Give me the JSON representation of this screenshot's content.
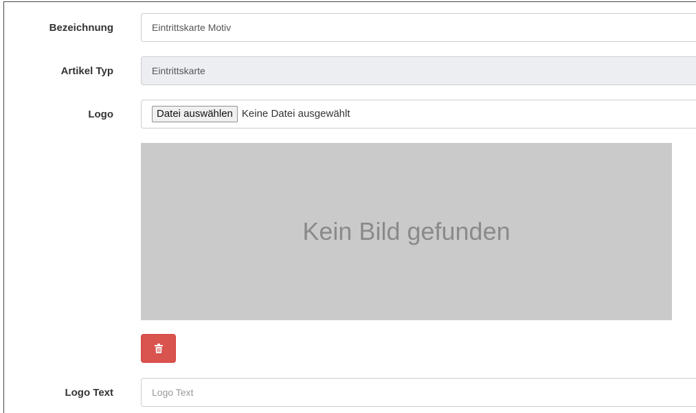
{
  "form": {
    "bezeichnung": {
      "label": "Bezeichnung",
      "value": "Eintrittskarte Motiv"
    },
    "artikel_typ": {
      "label": "Artikel Typ",
      "value": "Eintrittskarte"
    },
    "logo": {
      "label": "Logo",
      "choose_button": "Datei auswählen",
      "file_status": "Keine Datei ausgewählt",
      "preview_text": "Kein Bild gefunden",
      "delete_icon": "trash-icon",
      "delete_color": "#d9534f"
    },
    "logo_text": {
      "label": "Logo Text",
      "placeholder": "Logo Text"
    }
  }
}
